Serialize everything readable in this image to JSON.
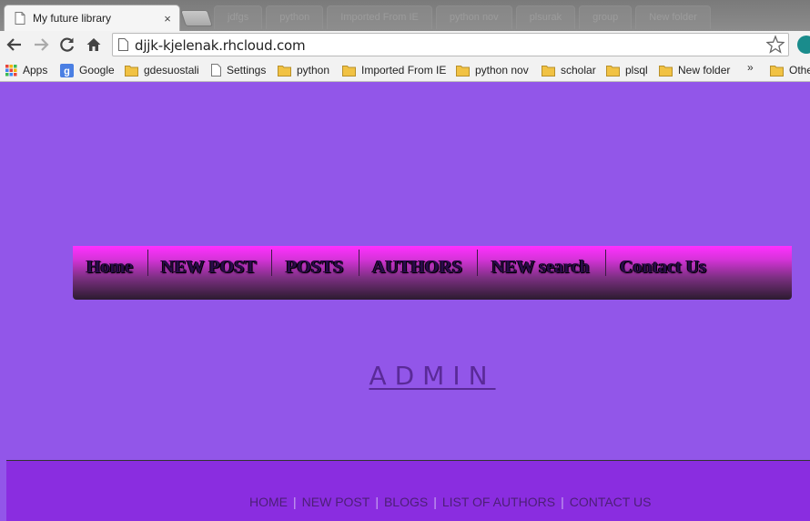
{
  "browser": {
    "active_tab": {
      "title": "My future library",
      "close_glyph": "×"
    },
    "background_tabs": [
      "jdfgs",
      "python",
      "Imported From IE",
      "python nov",
      "plsurak",
      "group",
      "New folder"
    ],
    "address": {
      "url": "djjk-kjelenak.rhcloud.com"
    },
    "nav": {
      "back_icon": "back-arrow-icon",
      "forward_icon": "forward-arrow-icon",
      "reload_icon": "reload-icon",
      "home_icon": "home-icon"
    },
    "bookmarks": [
      {
        "label": "Apps",
        "icon": "apps-grid-icon"
      },
      {
        "label": "Google",
        "icon": "google-icon"
      },
      {
        "label": "gdesuostali",
        "icon": "folder-icon"
      },
      {
        "label": "Settings",
        "icon": "page-icon"
      },
      {
        "label": "python",
        "icon": "folder-icon"
      },
      {
        "label": "Imported From IE",
        "icon": "folder-icon"
      },
      {
        "label": "python nov",
        "icon": "folder-icon"
      },
      {
        "label": "scholar",
        "icon": "folder-icon"
      },
      {
        "label": "plsql",
        "icon": "folder-icon"
      },
      {
        "label": "New folder",
        "icon": "folder-icon"
      },
      {
        "label": "Othe",
        "icon": "folder-icon"
      }
    ],
    "bookmarks_overflow": "»"
  },
  "page": {
    "nav_items": [
      "Home",
      "NEW POST",
      "POSTS",
      "AUTHORS",
      "NEW search",
      "Contact Us"
    ],
    "heading": "ADMIN",
    "footer_links": [
      "HOME",
      "NEW POST",
      "BLOGS",
      "LIST OF AUTHORS",
      "CONTACT US"
    ],
    "footer_separator": "|"
  },
  "colors": {
    "page_background": "#9256e9",
    "footer_background": "#8a2de0",
    "nav_gradient_top": "#ff30ff",
    "nav_gradient_bottom": "#2b1b2f",
    "heading_color": "#5a2a98"
  }
}
